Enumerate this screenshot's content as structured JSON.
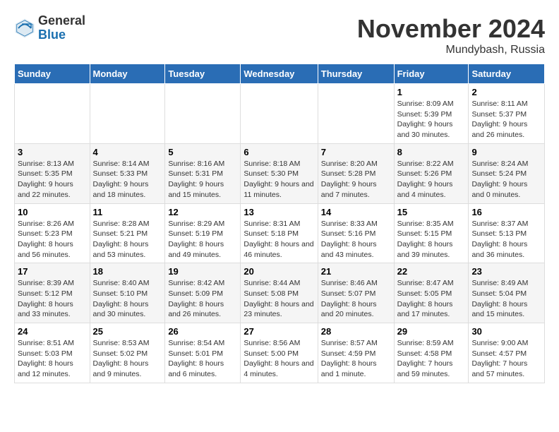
{
  "logo": {
    "general": "General",
    "blue": "Blue"
  },
  "title": "November 2024",
  "location": "Mundybash, Russia",
  "days_of_week": [
    "Sunday",
    "Monday",
    "Tuesday",
    "Wednesday",
    "Thursday",
    "Friday",
    "Saturday"
  ],
  "weeks": [
    [
      {
        "day": "",
        "detail": ""
      },
      {
        "day": "",
        "detail": ""
      },
      {
        "day": "",
        "detail": ""
      },
      {
        "day": "",
        "detail": ""
      },
      {
        "day": "",
        "detail": ""
      },
      {
        "day": "1",
        "detail": "Sunrise: 8:09 AM\nSunset: 5:39 PM\nDaylight: 9 hours and 30 minutes."
      },
      {
        "day": "2",
        "detail": "Sunrise: 8:11 AM\nSunset: 5:37 PM\nDaylight: 9 hours and 26 minutes."
      }
    ],
    [
      {
        "day": "3",
        "detail": "Sunrise: 8:13 AM\nSunset: 5:35 PM\nDaylight: 9 hours and 22 minutes."
      },
      {
        "day": "4",
        "detail": "Sunrise: 8:14 AM\nSunset: 5:33 PM\nDaylight: 9 hours and 18 minutes."
      },
      {
        "day": "5",
        "detail": "Sunrise: 8:16 AM\nSunset: 5:31 PM\nDaylight: 9 hours and 15 minutes."
      },
      {
        "day": "6",
        "detail": "Sunrise: 8:18 AM\nSunset: 5:30 PM\nDaylight: 9 hours and 11 minutes."
      },
      {
        "day": "7",
        "detail": "Sunrise: 8:20 AM\nSunset: 5:28 PM\nDaylight: 9 hours and 7 minutes."
      },
      {
        "day": "8",
        "detail": "Sunrise: 8:22 AM\nSunset: 5:26 PM\nDaylight: 9 hours and 4 minutes."
      },
      {
        "day": "9",
        "detail": "Sunrise: 8:24 AM\nSunset: 5:24 PM\nDaylight: 9 hours and 0 minutes."
      }
    ],
    [
      {
        "day": "10",
        "detail": "Sunrise: 8:26 AM\nSunset: 5:23 PM\nDaylight: 8 hours and 56 minutes."
      },
      {
        "day": "11",
        "detail": "Sunrise: 8:28 AM\nSunset: 5:21 PM\nDaylight: 8 hours and 53 minutes."
      },
      {
        "day": "12",
        "detail": "Sunrise: 8:29 AM\nSunset: 5:19 PM\nDaylight: 8 hours and 49 minutes."
      },
      {
        "day": "13",
        "detail": "Sunrise: 8:31 AM\nSunset: 5:18 PM\nDaylight: 8 hours and 46 minutes."
      },
      {
        "day": "14",
        "detail": "Sunrise: 8:33 AM\nSunset: 5:16 PM\nDaylight: 8 hours and 43 minutes."
      },
      {
        "day": "15",
        "detail": "Sunrise: 8:35 AM\nSunset: 5:15 PM\nDaylight: 8 hours and 39 minutes."
      },
      {
        "day": "16",
        "detail": "Sunrise: 8:37 AM\nSunset: 5:13 PM\nDaylight: 8 hours and 36 minutes."
      }
    ],
    [
      {
        "day": "17",
        "detail": "Sunrise: 8:39 AM\nSunset: 5:12 PM\nDaylight: 8 hours and 33 minutes."
      },
      {
        "day": "18",
        "detail": "Sunrise: 8:40 AM\nSunset: 5:10 PM\nDaylight: 8 hours and 30 minutes."
      },
      {
        "day": "19",
        "detail": "Sunrise: 8:42 AM\nSunset: 5:09 PM\nDaylight: 8 hours and 26 minutes."
      },
      {
        "day": "20",
        "detail": "Sunrise: 8:44 AM\nSunset: 5:08 PM\nDaylight: 8 hours and 23 minutes."
      },
      {
        "day": "21",
        "detail": "Sunrise: 8:46 AM\nSunset: 5:07 PM\nDaylight: 8 hours and 20 minutes."
      },
      {
        "day": "22",
        "detail": "Sunrise: 8:47 AM\nSunset: 5:05 PM\nDaylight: 8 hours and 17 minutes."
      },
      {
        "day": "23",
        "detail": "Sunrise: 8:49 AM\nSunset: 5:04 PM\nDaylight: 8 hours and 15 minutes."
      }
    ],
    [
      {
        "day": "24",
        "detail": "Sunrise: 8:51 AM\nSunset: 5:03 PM\nDaylight: 8 hours and 12 minutes."
      },
      {
        "day": "25",
        "detail": "Sunrise: 8:53 AM\nSunset: 5:02 PM\nDaylight: 8 hours and 9 minutes."
      },
      {
        "day": "26",
        "detail": "Sunrise: 8:54 AM\nSunset: 5:01 PM\nDaylight: 8 hours and 6 minutes."
      },
      {
        "day": "27",
        "detail": "Sunrise: 8:56 AM\nSunset: 5:00 PM\nDaylight: 8 hours and 4 minutes."
      },
      {
        "day": "28",
        "detail": "Sunrise: 8:57 AM\nSunset: 4:59 PM\nDaylight: 8 hours and 1 minute."
      },
      {
        "day": "29",
        "detail": "Sunrise: 8:59 AM\nSunset: 4:58 PM\nDaylight: 7 hours and 59 minutes."
      },
      {
        "day": "30",
        "detail": "Sunrise: 9:00 AM\nSunset: 4:57 PM\nDaylight: 7 hours and 57 minutes."
      }
    ]
  ]
}
